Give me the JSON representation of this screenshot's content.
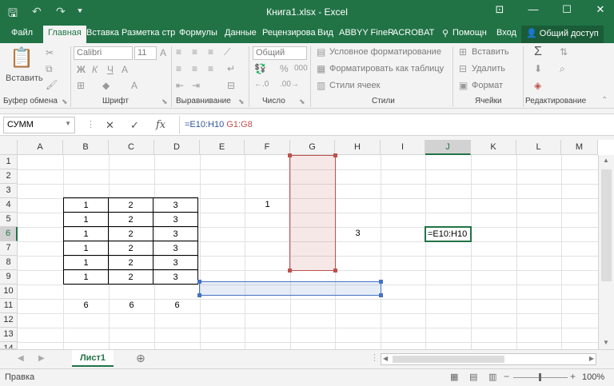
{
  "window": {
    "title": "Книга1.xlsx - Excel",
    "controls": [
      "⊡",
      "—",
      "☐",
      "✕"
    ]
  },
  "tabs": [
    "Файл",
    "Главная",
    "Вставка",
    "Разметка стр",
    "Формулы",
    "Данные",
    "Рецензирова",
    "Вид",
    "ABBYY FineR",
    "ACROBAT"
  ],
  "tell_me": "Помощн",
  "signin": "Вход",
  "share": "Общий доступ",
  "ribbon": {
    "clipboard": {
      "paste": "Вставить",
      "label": "Буфер обмена"
    },
    "font": {
      "name": "Calibri",
      "size": "11",
      "bold": "Ж",
      "italic": "К",
      "underline": "Ч",
      "label": "Шрифт"
    },
    "alignment": {
      "label": "Выравнивание"
    },
    "number": {
      "format": "Общий",
      "percent": "%",
      "thousands": "000",
      "label": "Число"
    },
    "styles": {
      "conditional": "Условное форматирование",
      "as_table": "Форматировать как таблицу",
      "cell_styles": "Стили ячеек",
      "label": "Стили"
    },
    "cells": {
      "insert": "Вставить",
      "delete": "Удалить",
      "format": "Формат",
      "label": "Ячейки"
    },
    "editing": {
      "label": "Редактирование"
    }
  },
  "formula_bar": {
    "name_box": "СУММ",
    "formula_part1": "=E10:H10",
    "formula_part2": "G1:G8",
    "fx": "fx"
  },
  "columns": [
    "A",
    "B",
    "C",
    "D",
    "E",
    "F",
    "G",
    "H",
    "I",
    "J",
    "K",
    "L",
    "M"
  ],
  "rows": [
    "1",
    "2",
    "3",
    "4",
    "5",
    "6",
    "7",
    "8",
    "9",
    "10",
    "11",
    "12",
    "13",
    "14"
  ],
  "table": [
    [
      "1",
      "2",
      "3"
    ],
    [
      "1",
      "2",
      "3"
    ],
    [
      "1",
      "2",
      "3"
    ],
    [
      "1",
      "2",
      "3"
    ],
    [
      "1",
      "2",
      "3"
    ],
    [
      "1",
      "2",
      "3"
    ]
  ],
  "totals": [
    "6",
    "6",
    "6"
  ],
  "f4": "1",
  "h6": "3",
  "j6": "=E10:H10 G",
  "sheet_tab": "Лист1",
  "status": {
    "mode": "Правка",
    "zoom": "100%"
  },
  "colors": {
    "brand": "#217346",
    "range1": "#4472c4",
    "range2": "#c0504d"
  }
}
